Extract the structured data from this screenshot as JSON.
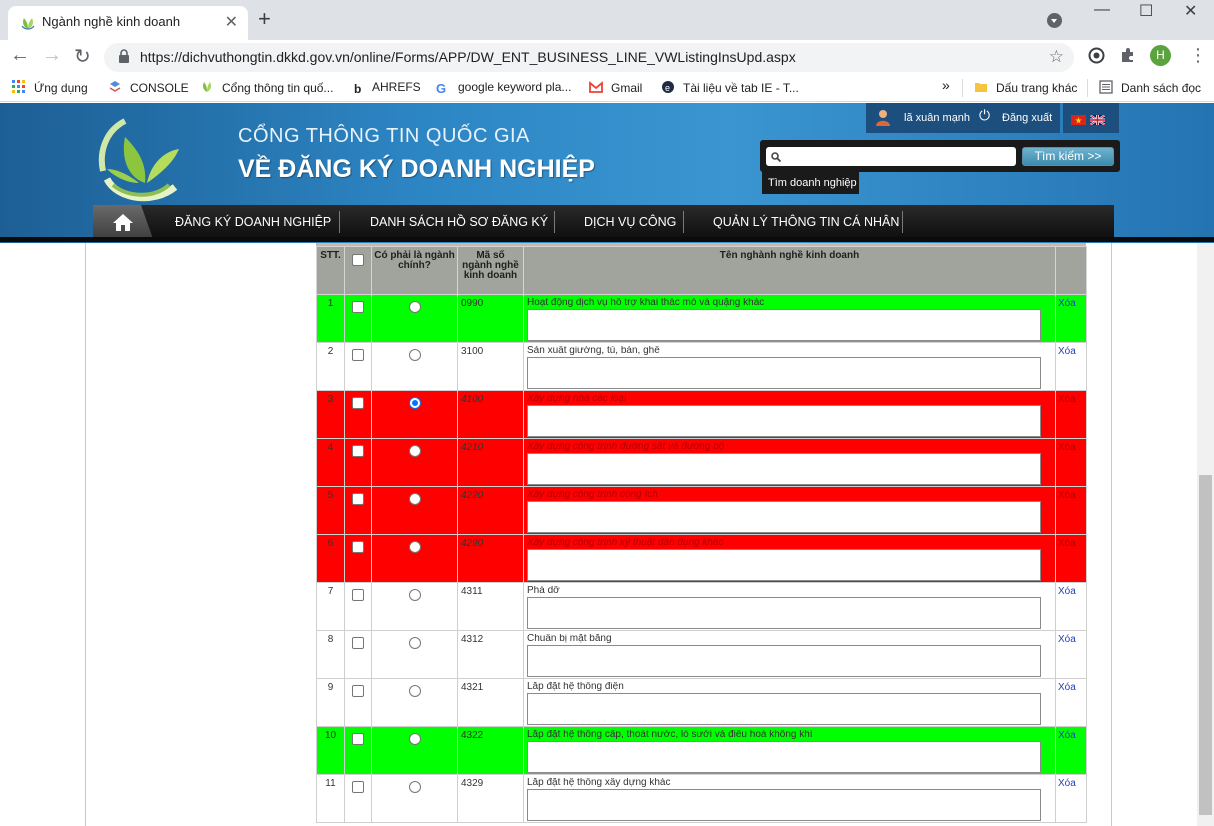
{
  "browser": {
    "tab_title": "Ngành nghề kinh doanh",
    "url": "https://dichvuthongtin.dkkd.gov.vn/online/Forms/APP/DW_ENT_BUSINESS_LINE_VWListingInsUpd.aspx",
    "profile_initial": "H",
    "bookmarks": [
      {
        "label": "Ứng dụng",
        "icon": "apps-grid-icon"
      },
      {
        "label": "CONSOLE",
        "icon": "console-icon"
      },
      {
        "label": "Cổng thông tin quố...",
        "icon": "leaf-logo-icon"
      },
      {
        "label": "AHREFS",
        "icon": "ahrefs-icon"
      },
      {
        "label": "google keyword pla...",
        "icon": "google-icon"
      },
      {
        "label": "Gmail",
        "icon": "gmail-icon"
      },
      {
        "label": "Tài liệu về tab IE - T...",
        "icon": "ie-icon"
      }
    ],
    "bookmarks_overflow": "»",
    "other_bookmarks": "Dấu trang khác",
    "reading_list": "Danh sách đọc"
  },
  "site": {
    "title_line1": "CỔNG THÔNG TIN QUỐC GIA",
    "title_line2": "VỀ ĐĂNG KÝ DOANH NGHIỆP",
    "user_name": "lã xuân mạnh",
    "logout": "Đăng xuất",
    "search_placeholder": "",
    "search_button": "Tìm kiếm >>",
    "search_tab": "Tìm doanh nghiệp",
    "nav": [
      "ĐĂNG KÝ DOANH NGHIỆP",
      "DANH SÁCH HỒ SƠ ĐĂNG KÝ",
      "DỊCH VỤ CÔNG",
      "QUẢN LÝ THÔNG TIN CÁ NHÂN"
    ]
  },
  "grid": {
    "headers": {
      "stt": "STT.",
      "main": "Có phải là ngành chính?",
      "code": "Mã số ngành nghề kinh doanh",
      "name": "Tên nghành nghề kinh doanh"
    },
    "delete_label": "Xóa",
    "row_colors": {
      "green": "#00ff00",
      "red": "#ff0000",
      "white": "#ffffff"
    },
    "rows": [
      {
        "stt": "1",
        "code": "0990",
        "name": "Hoạt động dịch vụ hỗ trợ khai thác mỏ và quặng khác",
        "highlight": "green",
        "main": false
      },
      {
        "stt": "2",
        "code": "3100",
        "name": "Sản xuất giường, tủ, bàn, ghế",
        "highlight": "none",
        "main": false
      },
      {
        "stt": "3",
        "code": "4100",
        "name": "Xây dựng nhà các loại",
        "highlight": "red",
        "main": true
      },
      {
        "stt": "4",
        "code": "4210",
        "name": "Xây dựng công trình đường sắt và đường bộ",
        "highlight": "red",
        "main": false
      },
      {
        "stt": "5",
        "code": "4220",
        "name": "Xây dựng công trình công ích",
        "highlight": "red",
        "main": false
      },
      {
        "stt": "6",
        "code": "4290",
        "name": "Xây dựng công trình kỹ thuật dân dụng khác",
        "highlight": "red",
        "main": false
      },
      {
        "stt": "7",
        "code": "4311",
        "name": "Phá dỡ",
        "highlight": "none",
        "main": false
      },
      {
        "stt": "8",
        "code": "4312",
        "name": "Chuẩn bị mặt bằng",
        "highlight": "none",
        "main": false
      },
      {
        "stt": "9",
        "code": "4321",
        "name": "Lắp đặt hệ thống điện",
        "highlight": "none",
        "main": false
      },
      {
        "stt": "10",
        "code": "4322",
        "name": "Lắp đặt hệ thống cấp, thoát nước, lò sưởi và điều hoà không khí",
        "highlight": "green",
        "main": false
      },
      {
        "stt": "11",
        "code": "4329",
        "name": "Lắp đặt hệ thống xây dựng khác",
        "highlight": "none",
        "main": false
      }
    ]
  }
}
